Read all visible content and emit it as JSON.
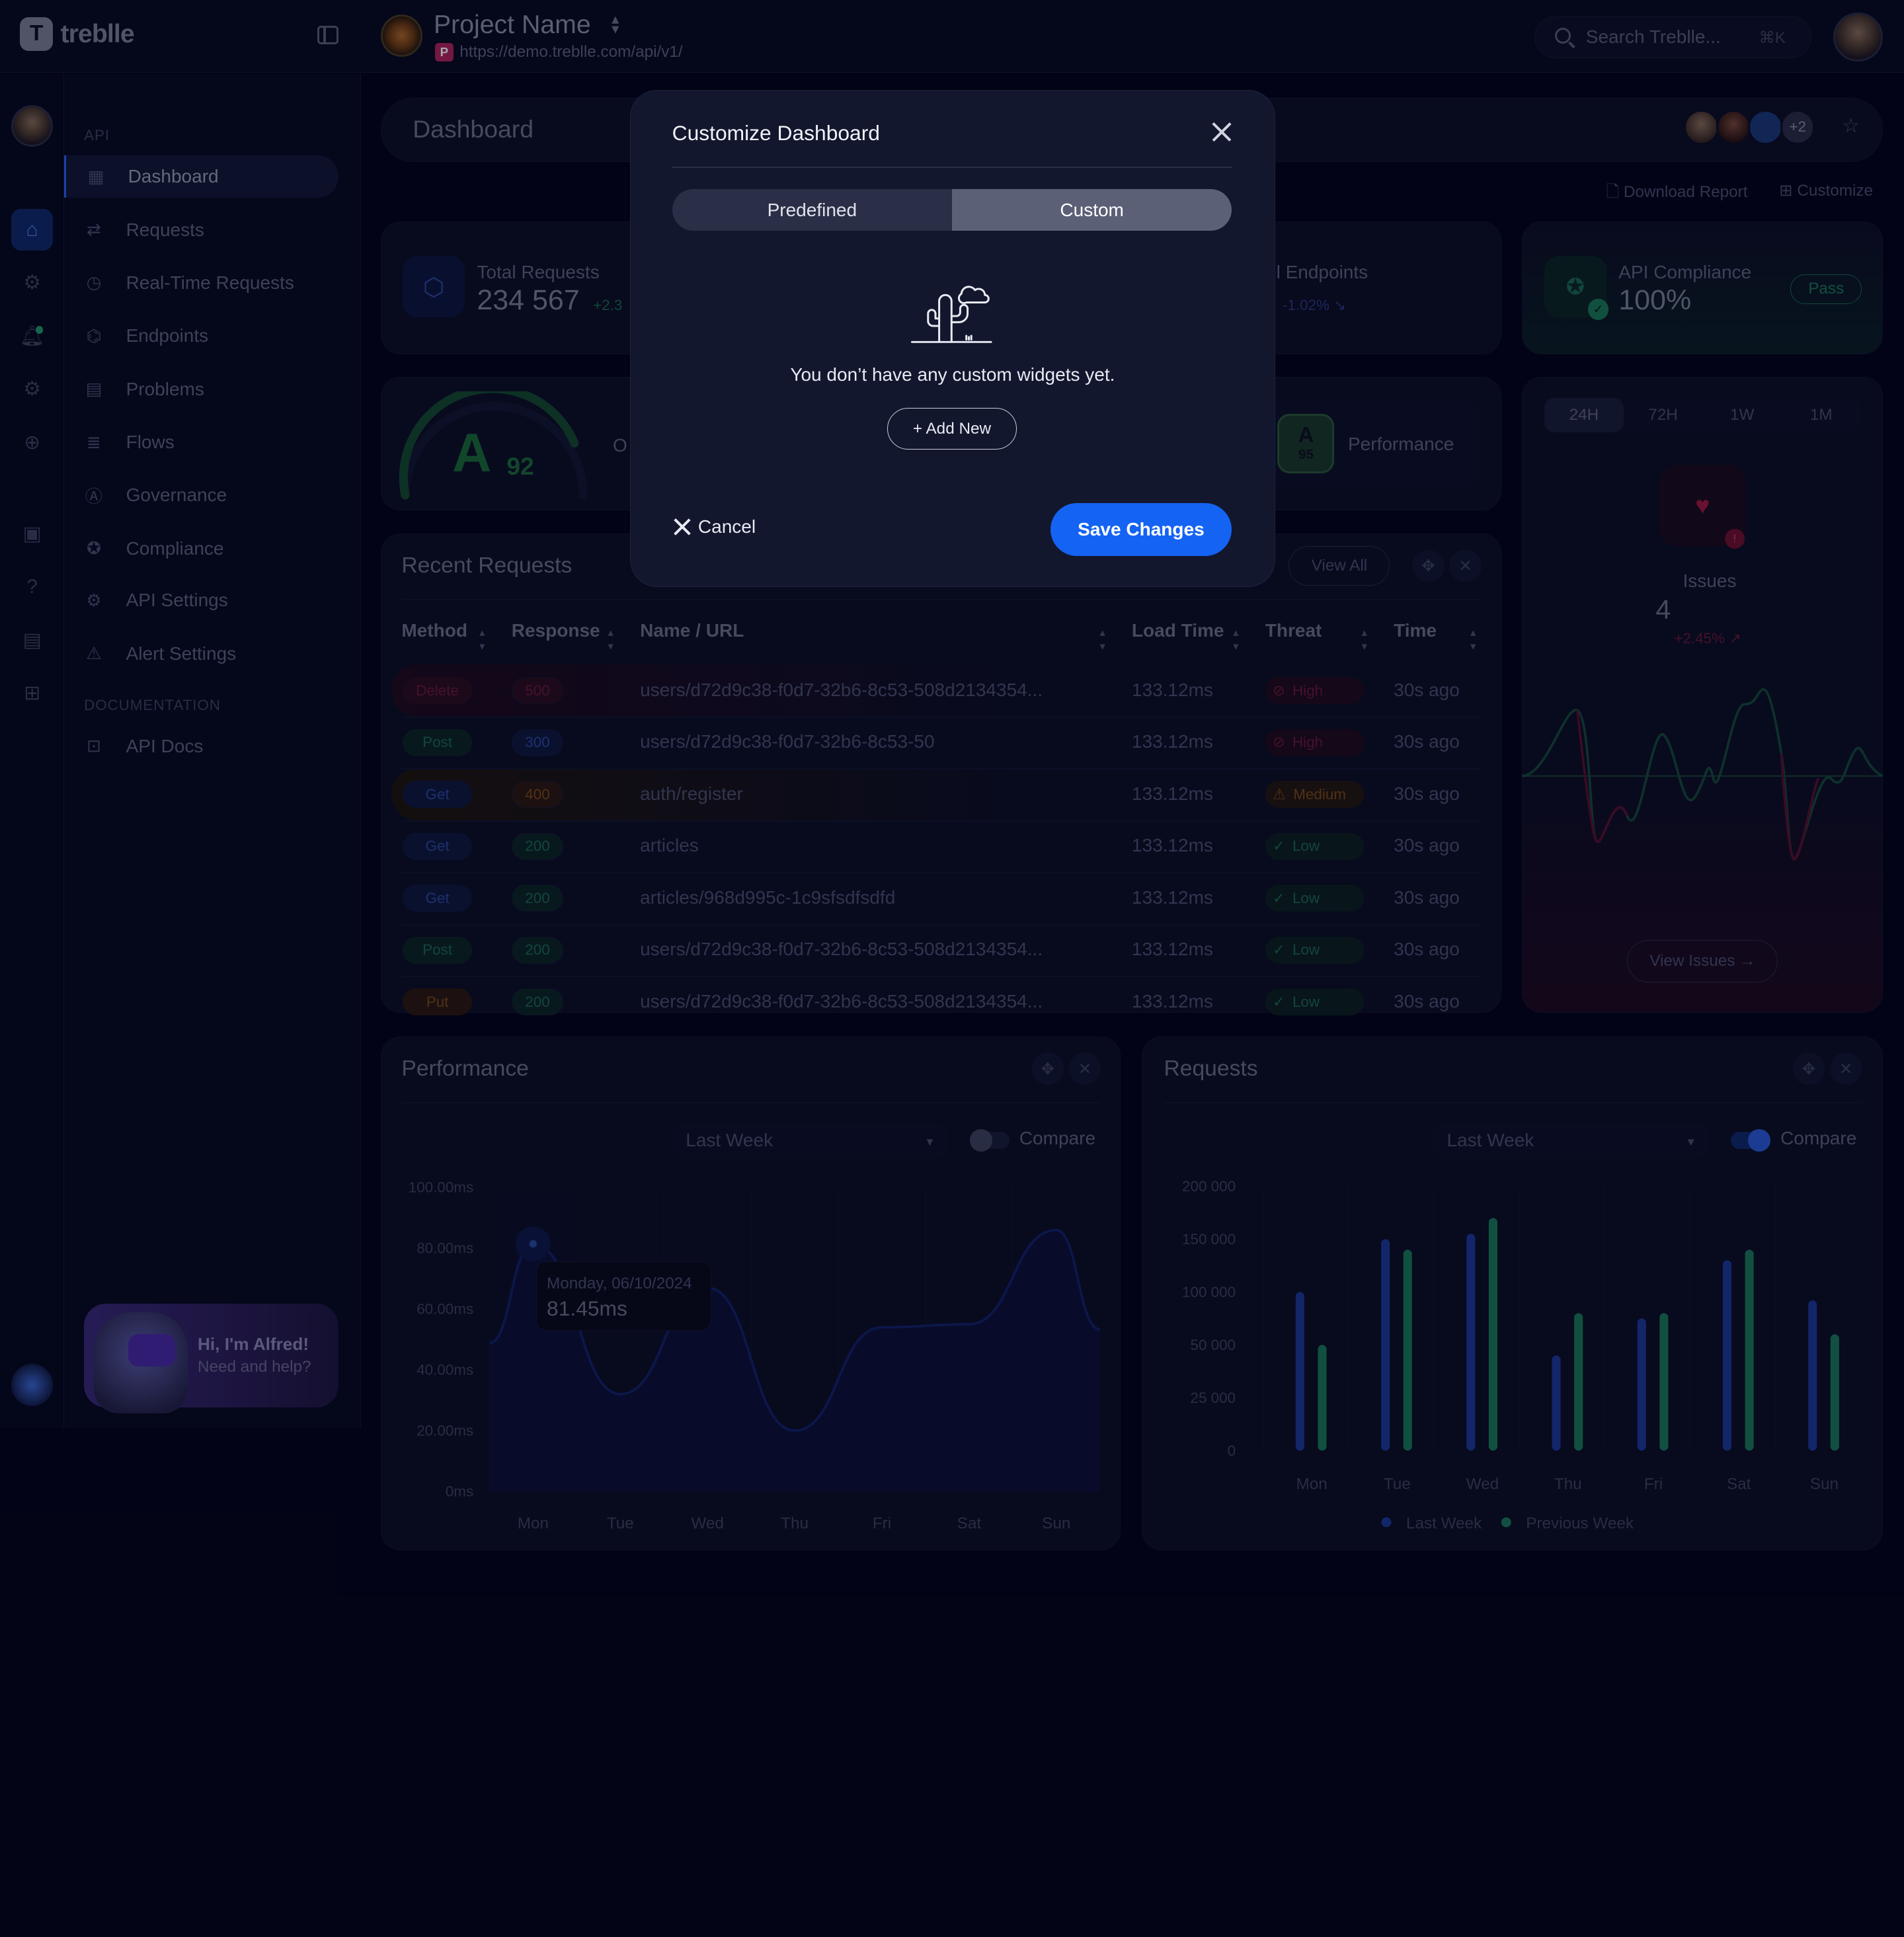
{
  "brand": {
    "name": "treblle",
    "mark": "T"
  },
  "project": {
    "name": "Project Name",
    "badge": "P",
    "url": "https://demo.treblle.com/api/v1/"
  },
  "search": {
    "placeholder": "Search Treblle...",
    "shortcut": "⌘K"
  },
  "sidebar": {
    "section_api": "API",
    "items": [
      {
        "label": "Dashboard",
        "icon": "grid-icon",
        "active": true
      },
      {
        "label": "Requests",
        "icon": "arrows-icon"
      },
      {
        "label": "Real-Time Requests",
        "icon": "realtime-icon"
      },
      {
        "label": "Endpoints",
        "icon": "endpoints-icon"
      },
      {
        "label": "Problems",
        "icon": "problems-icon"
      },
      {
        "label": "Flows",
        "icon": "flows-icon"
      },
      {
        "label": "Governance",
        "icon": "governance-icon"
      },
      {
        "label": "Compliance",
        "icon": "compliance-icon"
      },
      {
        "label": "API Settings",
        "icon": "gear-icon"
      },
      {
        "label": "Alert Settings",
        "icon": "alert-icon"
      }
    ],
    "section_docs": "DOCUMENTATION",
    "docs_items": [
      {
        "label": "API Docs",
        "icon": "docs-icon"
      }
    ]
  },
  "alfred": {
    "title": "Hi, I'm Alfred!",
    "subtitle": "Need and help?"
  },
  "header": {
    "title": "Dashboard",
    "facepile_more": "+2",
    "download_report": "Download Report",
    "customize": "Customize"
  },
  "stats": {
    "total_requests": {
      "label": "Total Requests",
      "value": "234 567",
      "change": "+2.3"
    },
    "endpoints": {
      "label": "l Endpoints",
      "change": "-1.02% ↘"
    },
    "compliance": {
      "label": "API Compliance",
      "value": "100%",
      "badge": "Pass"
    }
  },
  "score": {
    "grade": "A",
    "value": "92",
    "label_fragment": "O",
    "perf_grade": "A",
    "perf_value": "95",
    "perf_label": "Performance"
  },
  "issues": {
    "ranges": [
      "24H",
      "72H",
      "1W",
      "1M"
    ],
    "active_range": "24H",
    "label": "Issues",
    "value": "4",
    "change": "+2.45% ↗",
    "badge": "!",
    "button": "View Issues →"
  },
  "recent_requests": {
    "title": "Recent Requests",
    "view_all": "View All",
    "columns": [
      "Method",
      "Response",
      "Name / URL",
      "Load Time",
      "Threat",
      "Time"
    ],
    "rows": [
      {
        "method": "Delete",
        "response": "500",
        "url": "users/d72d9c38-f0d7-32b6-8c53-508d2134354...",
        "load": "133.12ms",
        "threat": "High",
        "time": "30s ago"
      },
      {
        "method": "Post",
        "response": "300",
        "url": "users/d72d9c38-f0d7-32b6-8c53-50",
        "load": "133.12ms",
        "threat": "High",
        "time": "30s ago"
      },
      {
        "method": "Get",
        "response": "400",
        "url": "auth/register",
        "load": "133.12ms",
        "threat": "Medium",
        "time": "30s ago"
      },
      {
        "method": "Get",
        "response": "200",
        "url": "articles",
        "load": "133.12ms",
        "threat": "Low",
        "time": "30s ago"
      },
      {
        "method": "Get",
        "response": "200",
        "url": "articles/968d995c-1c9sfsdfsdfd",
        "load": "133.12ms",
        "threat": "Low",
        "time": "30s ago"
      },
      {
        "method": "Post",
        "response": "200",
        "url": "users/d72d9c38-f0d7-32b6-8c53-508d2134354...",
        "load": "133.12ms",
        "threat": "Low",
        "time": "30s ago"
      },
      {
        "method": "Put",
        "response": "200",
        "url": "users/d72d9c38-f0d7-32b6-8c53-508d2134354...",
        "load": "133.12ms",
        "threat": "Low",
        "time": "30s ago"
      }
    ]
  },
  "performance_chart": {
    "title": "Performance",
    "period": "Last Week",
    "compare_label": "Compare",
    "compare_on": false,
    "tooltip": {
      "date": "Monday, 06/10/2024",
      "value": "81.45ms"
    }
  },
  "requests_chart": {
    "title": "Requests",
    "period": "Last Week",
    "compare_label": "Compare",
    "compare_on": true
  },
  "chart_data": [
    {
      "type": "area",
      "title": "Performance",
      "categories": [
        "Mon",
        "Tue",
        "Wed",
        "Thu",
        "Fri",
        "Sat",
        "Sun"
      ],
      "y_ticks": [
        "100.00ms",
        "80.00ms",
        "60.00ms",
        "40.00ms",
        "20.00ms",
        "0ms"
      ],
      "ylim": [
        0,
        100
      ],
      "series": [
        {
          "values": [
            81.45,
            32,
            67,
            20,
            54,
            55,
            86
          ]
        }
      ],
      "grid": true
    },
    {
      "type": "bar",
      "title": "Requests",
      "categories": [
        "Mon",
        "Tue",
        "Wed",
        "Thu",
        "Fri",
        "Sat",
        "Sun"
      ],
      "y_ticks": [
        "200 000",
        "150 000",
        "100 000",
        "50 000",
        "25 000",
        "0"
      ],
      "series": [
        {
          "name": "Last Week",
          "values": [
            100000,
            150000,
            155000,
            45000,
            75000,
            130000,
            92000
          ]
        },
        {
          "name": "Previous Week",
          "values": [
            50000,
            140000,
            170000,
            80000,
            80000,
            140000,
            60000
          ]
        }
      ],
      "legend": "bottom",
      "grid": true,
      "colors": [
        "#1d3a9a",
        "#1a7a5a"
      ]
    }
  ],
  "modal": {
    "title": "Customize Dashboard",
    "tabs": [
      "Predefined",
      "Custom"
    ],
    "active_tab": "Custom",
    "empty_text": "You don’t have any custom widgets yet.",
    "add_new": "+ Add New",
    "cancel": "Cancel",
    "save": "Save Changes"
  }
}
